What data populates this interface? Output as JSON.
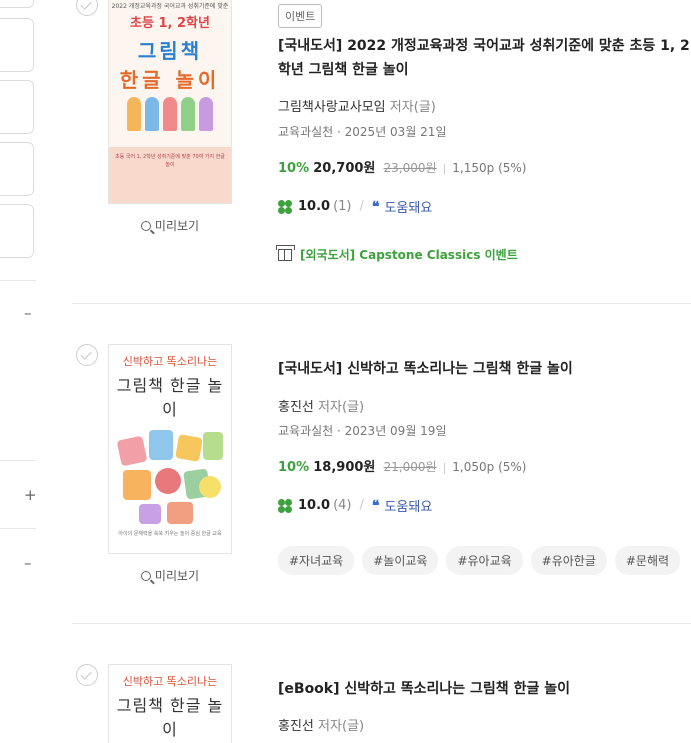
{
  "filter_strip": {
    "minus_1": "–",
    "plus": "+",
    "minus_2": "–"
  },
  "items": [
    {
      "badge": "이벤트",
      "title": "[국내도서] 2022 개정교육과정 국어교과 성취기준에 맞춘 초등 1, 2학년 그림책 한글 놀이",
      "author": "그림책사랑교사모임",
      "author_role": "저자(글)",
      "publisher": "교육과실천",
      "pub_date": "2025년 03월 21일",
      "discount": "10%",
      "sale_price": "20,700원",
      "orig_price": "23,000원",
      "points": "1,150p (5%)",
      "score": "10.0",
      "review_count": "(1)",
      "helpful": "도움돼요",
      "event": "[외국도서] Capstone Classics 이벤트",
      "preview": "미리보기",
      "cover": {
        "top": "2022 개정교육과정 국어교과 성취기준에 맞춘",
        "red": "초등 1, 2학년",
        "big1": "그림책",
        "big2": "한글 놀이",
        "band": "초등 국어 1, 2학년 성취기준에 맞춘 70여 가지 한글 놀이"
      }
    },
    {
      "title": "[국내도서] 신박하고 똑소리나는 그림책 한글 놀이",
      "author": "홍진선",
      "author_role": "저자(글)",
      "publisher": "교육과실천",
      "pub_date": "2023년 09월 19일",
      "discount": "10%",
      "sale_price": "18,900원",
      "orig_price": "21,000원",
      "points": "1,050p (5%)",
      "score": "10.0",
      "review_count": "(4)",
      "helpful": "도움돼요",
      "tags": [
        "#자녀교육",
        "#놀이교육",
        "#유아교육",
        "#유아한글",
        "#문해력"
      ],
      "preview": "미리보기",
      "cover": {
        "line1": "신박하고 똑소리나는",
        "line2": "그림책 한글 놀이",
        "foot": "아이의 문해력을 쑥쑥 키우는 놀이 중심 한글 교육"
      }
    },
    {
      "title": "[eBook] 신박하고 똑소리나는 그림책 한글 놀이",
      "author": "홍진선",
      "author_role": "저자(글)",
      "cover": {
        "line1": "신박하고 똑소리나는",
        "line2": "그림책 한글 놀이"
      }
    }
  ]
}
